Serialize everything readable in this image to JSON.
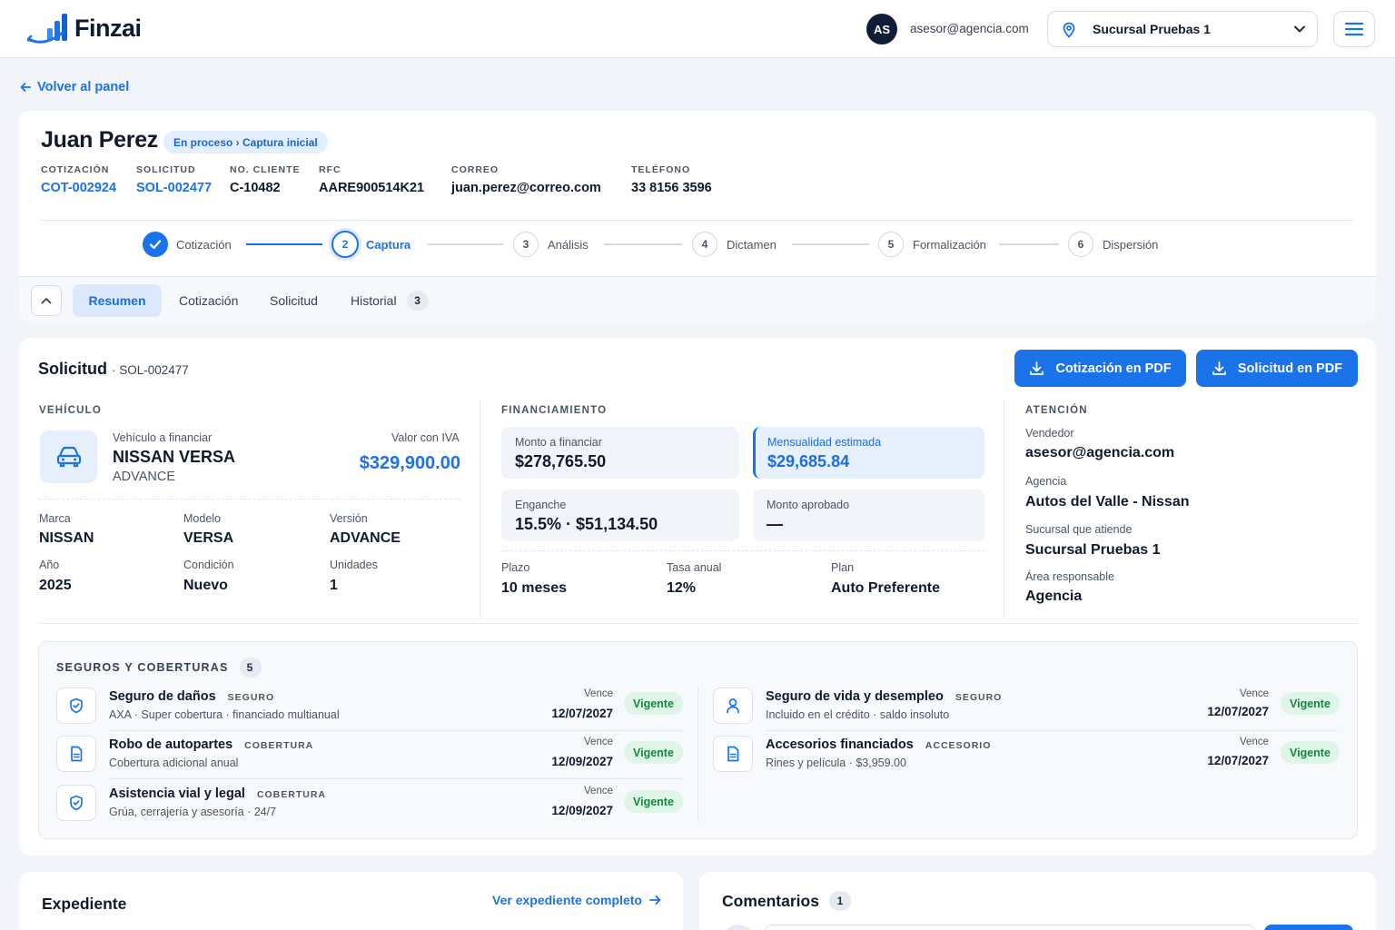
{
  "header": {
    "brand": "Finzai",
    "avatar_initials": "AS",
    "user_email": "asesor@agencia.com",
    "branch": "Sucursal Pruebas 1"
  },
  "back_link": "Volver al panel",
  "client": {
    "name": "Juan Perez",
    "status": "En proceso › Captura inicial",
    "meta": [
      {
        "label": "COTIZACIÓN",
        "value": "COT-002924"
      },
      {
        "label": "SOLICITUD",
        "value": "SOL-002477"
      },
      {
        "label": "NO. CLIENTE",
        "value": "C-10482"
      },
      {
        "label": "RFC",
        "value": "AARE900514K21"
      },
      {
        "label": "CORREO",
        "value": "juan.perez@correo.com"
      },
      {
        "label": "TELÉFONO",
        "value": "33 8156 3596"
      }
    ]
  },
  "stepper": {
    "current_step": 2,
    "steps": [
      {
        "number": "1",
        "label": "Cotización",
        "state": "done"
      },
      {
        "number": "2",
        "label": "Captura",
        "state": "current"
      },
      {
        "number": "3",
        "label": "Análisis",
        "state": "pending"
      },
      {
        "number": "4",
        "label": "Dictamen",
        "state": "pending"
      },
      {
        "number": "5",
        "label": "Formalización",
        "state": "pending"
      },
      {
        "number": "6",
        "label": "Dispersión",
        "state": "pending"
      }
    ]
  },
  "tabs": [
    {
      "label": "Resumen",
      "active": true
    },
    {
      "label": "Cotización"
    },
    {
      "label": "Solicitud"
    },
    {
      "label": "Historial",
      "count": "3"
    }
  ],
  "solicitud": {
    "title": "Solicitud",
    "id": "· SOL-002477",
    "pdf_cotizacion": "Cotización en PDF",
    "pdf_solicitud": "Solicitud en PDF",
    "vehiculo": {
      "heading": "VEHÍCULO",
      "financed_label": "Vehículo a financiar",
      "name": "NISSAN VERSA",
      "trim": "ADVANCE",
      "price_label": "Valor con IVA",
      "price": "$329,900.00",
      "fields": [
        {
          "label": "Marca",
          "value": "NISSAN"
        },
        {
          "label": "Modelo",
          "value": "VERSA"
        },
        {
          "label": "Versión",
          "value": "ADVANCE"
        },
        {
          "label": "Año",
          "value": "2025"
        },
        {
          "label": "Condición",
          "value": "Nuevo"
        },
        {
          "label": "Unidades",
          "value": "1"
        }
      ]
    },
    "financiamiento": {
      "heading": "FINANCIAMIENTO",
      "tiles": [
        {
          "label": "Monto a financiar",
          "value": "$278,765.50"
        },
        {
          "label": "Mensualidad estimada",
          "value": "$29,685.84"
        },
        {
          "label": "Enganche",
          "value": "15.5% · $51,134.50"
        },
        {
          "label": "Monto aprobado",
          "value": "—"
        }
      ],
      "fields": [
        {
          "label": "Plazo",
          "value": "10 meses"
        },
        {
          "label": "Tasa anual",
          "value": "12%"
        },
        {
          "label": "Plan",
          "value": "Auto Preferente"
        }
      ]
    },
    "atencion": {
      "heading": "ATENCIÓN",
      "fields": [
        {
          "label": "Vendedor",
          "value": "asesor@agencia.com"
        },
        {
          "label": "Agencia",
          "value": "Autos del Valle - Nissan"
        },
        {
          "label": "Sucursal que atiende",
          "value": "Sucursal Pruebas 1"
        },
        {
          "label": "Área responsable",
          "value": "Agencia"
        }
      ]
    }
  },
  "seguros": {
    "heading": "SEGUROS Y COBERTURAS",
    "count": "5",
    "vence_label": "Vence",
    "items": [
      {
        "title": "Seguro de daños",
        "tag": "SEGURO",
        "desc": "AXA · Super cobertura · financiado multianual",
        "date": "12/07/2027",
        "status": "Vigente",
        "icon": "shield-icon"
      },
      {
        "title": "Robo de autopartes",
        "tag": "COBERTURA",
        "desc": "Cobertura adicional anual",
        "date": "12/09/2027",
        "status": "Vigente",
        "icon": "document-icon"
      },
      {
        "title": "Asistencia vial y legal",
        "tag": "COBERTURA",
        "desc": "Grúa, cerrajería y asesoría · 24/7",
        "date": "12/09/2027",
        "status": "Vigente",
        "icon": "shield-icon"
      },
      {
        "title": "Seguro de vida y desempleo",
        "tag": "SEGURO",
        "desc": "Incluido en el crédito · saldo insoluto",
        "date": "12/07/2027",
        "status": "Vigente",
        "icon": "person-icon"
      },
      {
        "title": "Accesorios financiados",
        "tag": "ACCESORIO",
        "desc": "Rines y película · $3,959.00",
        "date": "12/07/2027",
        "status": "Vigente",
        "icon": "document-icon"
      }
    ]
  },
  "expediente": {
    "title": "Expediente",
    "link": "Ver expediente completo"
  },
  "comentarios": {
    "title": "Comentarios",
    "count": "1"
  },
  "colors": {
    "primary": "#1a73e8",
    "dark": "#0f1b2d",
    "success_bg": "#def5e7",
    "success_text": "#17863f"
  }
}
